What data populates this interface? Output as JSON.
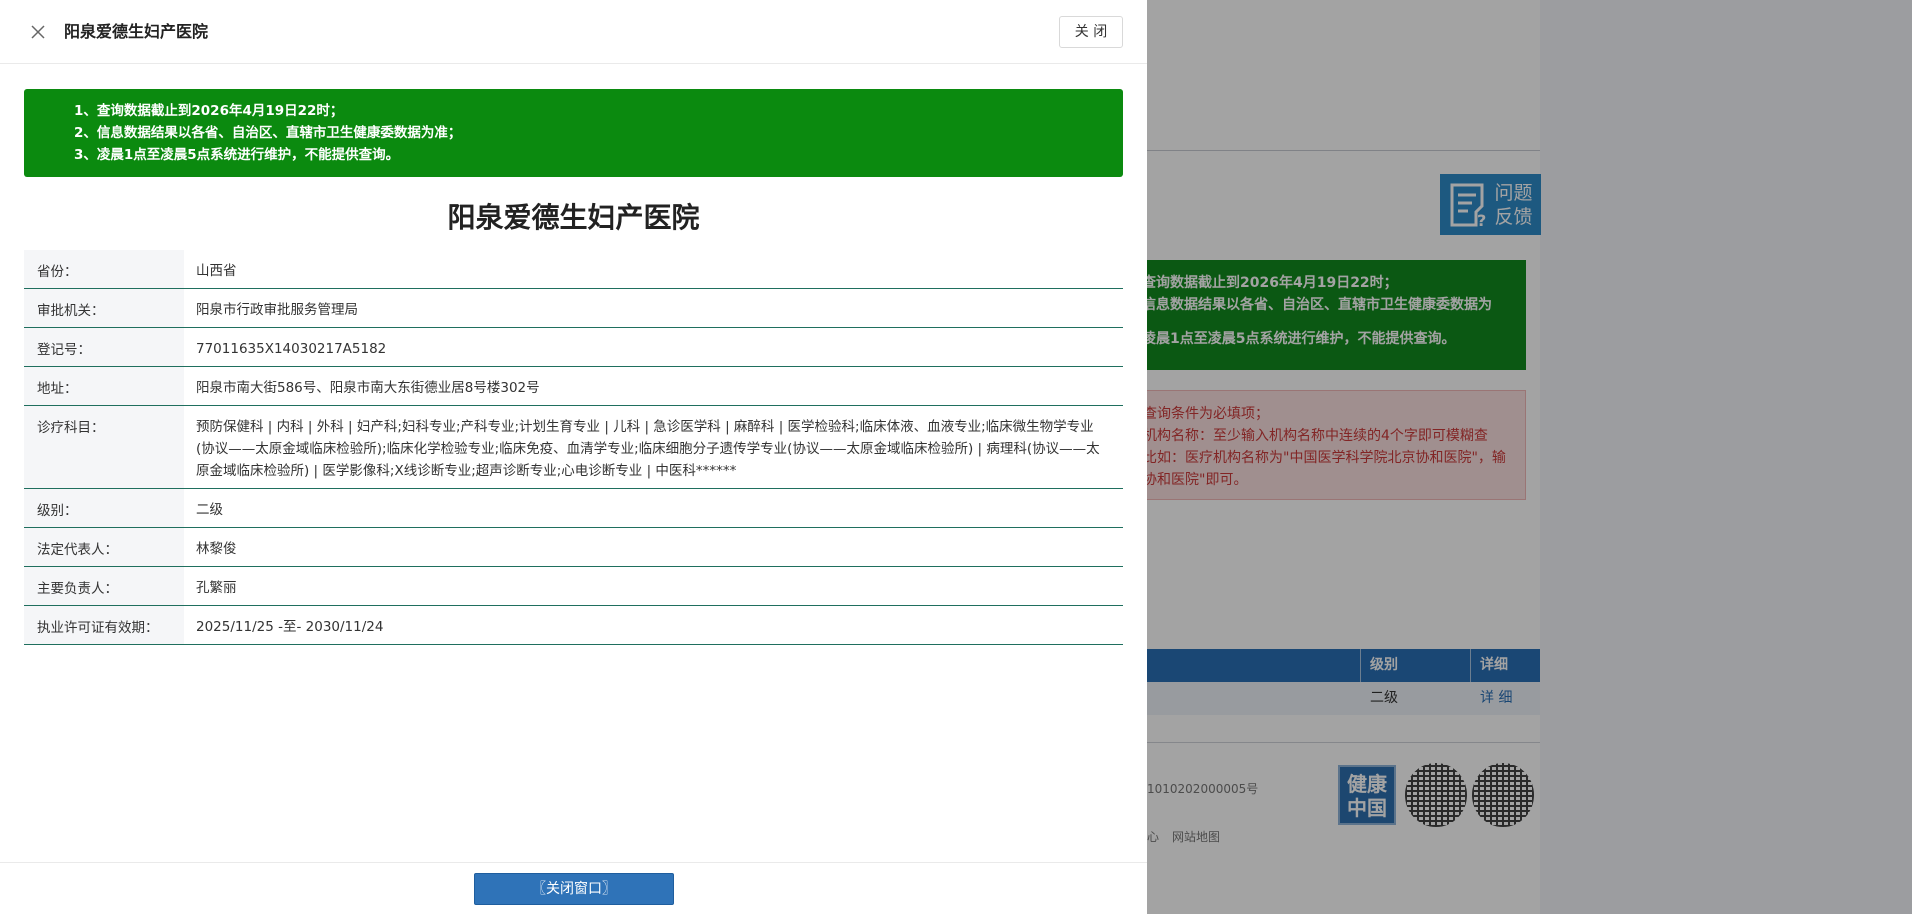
{
  "background": {
    "feedback_button": {
      "line1": "问题",
      "line2": "反馈"
    },
    "notice_green": [
      "查询数据截止到2026年4月19日22时；",
      "信息数据结果以各省、自治区、直辖市卫生健康委数据为",
      "凌晨1点至凌晨5点系统进行维护，不能提供查询。"
    ],
    "notice_red": [
      "查询条件为必填项；",
      "机构名称：至少输入机构名称中连续的4个字即可模糊查",
      "比如：医疗机构名称为\"中国医学科学院北京协和医院\"，输",
      "协和医院\"即可。"
    ],
    "table": {
      "headers": {
        "level": "级别",
        "detail": "详细"
      },
      "rows": [
        {
          "level": "二级",
          "detail": "详 细"
        }
      ]
    },
    "footer": {
      "record_number": "1010202000005号",
      "link_left": "心",
      "sitemap": "网站地图",
      "health_logo": {
        "line1": "健康",
        "line2": "中国"
      }
    }
  },
  "dialog": {
    "title": "阳泉爱德生妇产医院",
    "close_button": "关 闭",
    "notice": [
      "1、查询数据截止到2026年4月19日22时；",
      "2、信息数据结果以各省、自治区、直辖市卫生健康委数据为准；",
      "3、凌晨1点至凌晨5点系统进行维护，不能提供查询。"
    ],
    "hospital_name": "阳泉爱德生妇产医院",
    "fields": [
      {
        "label": "省份：",
        "value": "山西省"
      },
      {
        "label": "审批机关：",
        "value": "阳泉市行政审批服务管理局"
      },
      {
        "label": "登记号：",
        "value": "77011635X14030217A5182"
      },
      {
        "label": "地址：",
        "value": "阳泉市南大街586号、阳泉市南大东街德业居8号楼302号"
      },
      {
        "label": "诊疗科目：",
        "value": "预防保健科 | 内科 | 外科 | 妇产科;妇科专业;产科专业;计划生育专业 | 儿科 | 急诊医学科 | 麻醉科 | 医学检验科;临床体液、血液专业;临床微生物学专业(协议——太原金域临床检验所);临床化学检验专业;临床免疫、血清学专业;临床细胞分子遗传学专业(协议——太原金域临床检验所) | 病理科(协议——太原金域临床检验所) | 医学影像科;X线诊断专业;超声诊断专业;心电诊断专业 | 中医科******"
      },
      {
        "label": "级别：",
        "value": "二级"
      },
      {
        "label": "法定代表人：",
        "value": "林黎俊"
      },
      {
        "label": "主要负责人：",
        "value": "孔繁丽"
      },
      {
        "label": "执业许可证有效期：",
        "value": "2025/11/25 -至- 2030/11/24"
      }
    ],
    "close_window_button": "〖关闭窗口〗"
  }
}
